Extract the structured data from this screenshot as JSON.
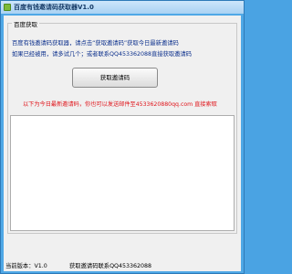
{
  "window": {
    "title": "百度有钱邀请码获取器V1.0"
  },
  "group": {
    "label": "百度获取",
    "line1": "百度有钱邀请码获取器，请点击“获取邀请码”获取今日最新邀请码",
    "line2": "如果已经被用，请多试几个；或者联系QQ453362088直接获取邀请码"
  },
  "button": {
    "label": "获取邀请码"
  },
  "notice": "以下为今日最新邀请码，你也可以发送邮件至4533620880qq.com 直接索取",
  "textarea": {
    "value": ""
  },
  "status": {
    "version": "当前版本：V1.0",
    "contact": "获取邀请码联系QQ453362088"
  },
  "colors": {
    "accent_blue": "#0b2f8c",
    "notice_red": "#e0141a",
    "frame_blue": "#4fa8e6"
  }
}
